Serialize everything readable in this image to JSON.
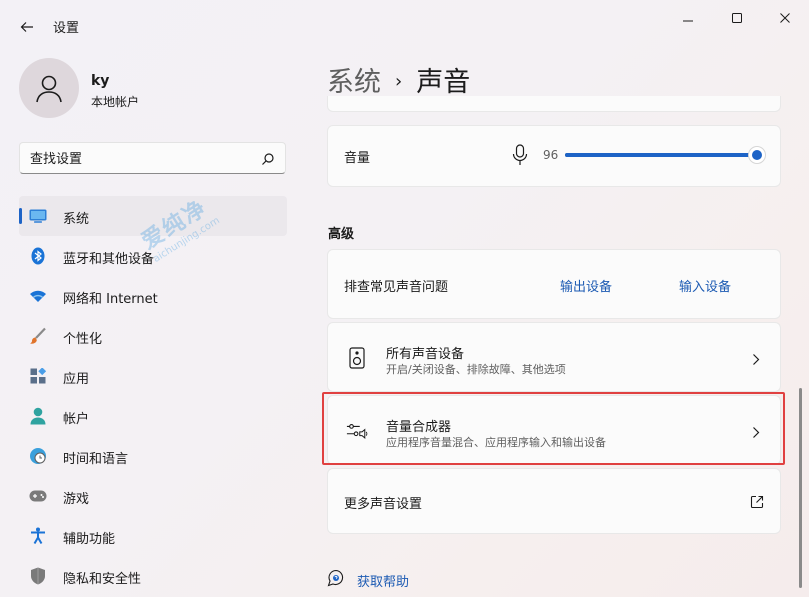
{
  "app": {
    "title": "设置"
  },
  "profile": {
    "name": "ky",
    "account_type": "本地帐户"
  },
  "search": {
    "placeholder": "查找设置"
  },
  "sidebar": {
    "items": [
      {
        "label": "系统",
        "icon": "monitor-icon",
        "active": true
      },
      {
        "label": "蓝牙和其他设备",
        "icon": "bluetooth-icon"
      },
      {
        "label": "网络和 Internet",
        "icon": "wifi-icon"
      },
      {
        "label": "个性化",
        "icon": "brush-icon"
      },
      {
        "label": "应用",
        "icon": "apps-icon"
      },
      {
        "label": "帐户",
        "icon": "person-icon"
      },
      {
        "label": "时间和语言",
        "icon": "globe-clock-icon"
      },
      {
        "label": "游戏",
        "icon": "gamepad-icon"
      },
      {
        "label": "辅助功能",
        "icon": "accessibility-icon"
      },
      {
        "label": "隐私和安全性",
        "icon": "shield-icon"
      }
    ]
  },
  "breadcrumb": {
    "parent": "系统",
    "separator": "›",
    "current": "声音"
  },
  "volume": {
    "label": "音量",
    "value": "96",
    "level_percent": 96
  },
  "advanced": {
    "title": "高级",
    "troubleshoot": {
      "label": "排查常见声音问题",
      "output_link": "输出设备",
      "input_link": "输入设备"
    },
    "all_devices": {
      "title": "所有声音设备",
      "subtitle": "开启/关闭设备、排除故障、其他选项"
    },
    "mixer": {
      "title": "音量合成器",
      "subtitle": "应用程序音量混合、应用程序输入和输出设备"
    },
    "more": {
      "label": "更多声音设置"
    }
  },
  "help": {
    "label": "获取帮助"
  },
  "watermark": {
    "brand": "爱纯净",
    "url": "aichunjing.com"
  },
  "colors": {
    "accent": "#1d63c6",
    "link": "#1d5bb3",
    "highlight": "#e04040"
  }
}
